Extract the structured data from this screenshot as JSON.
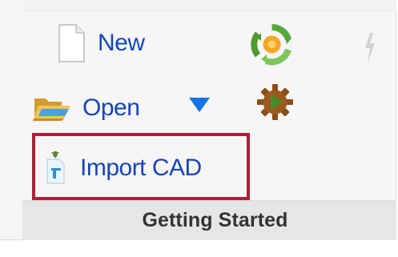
{
  "ribbon_group": {
    "title": "Getting Started",
    "commands": {
      "new": {
        "label": "New",
        "icon": "new-document-icon"
      },
      "open": {
        "label": "Open",
        "icon": "open-folder-icon",
        "dropdown_icon": "chevron-down-icon"
      },
      "import_cad": {
        "label": "Import CAD",
        "icon": "import-cad-icon"
      }
    },
    "tools": [
      {
        "name": "refresh-icon"
      },
      {
        "name": "gear-icon"
      },
      {
        "name": "lightning-icon"
      }
    ]
  },
  "colors": {
    "label_blue": "#1646b8",
    "highlight_red": "#ad1f35",
    "footer_bg": "#e6e6e6",
    "ribbon_bg": "#f6f6f6"
  }
}
